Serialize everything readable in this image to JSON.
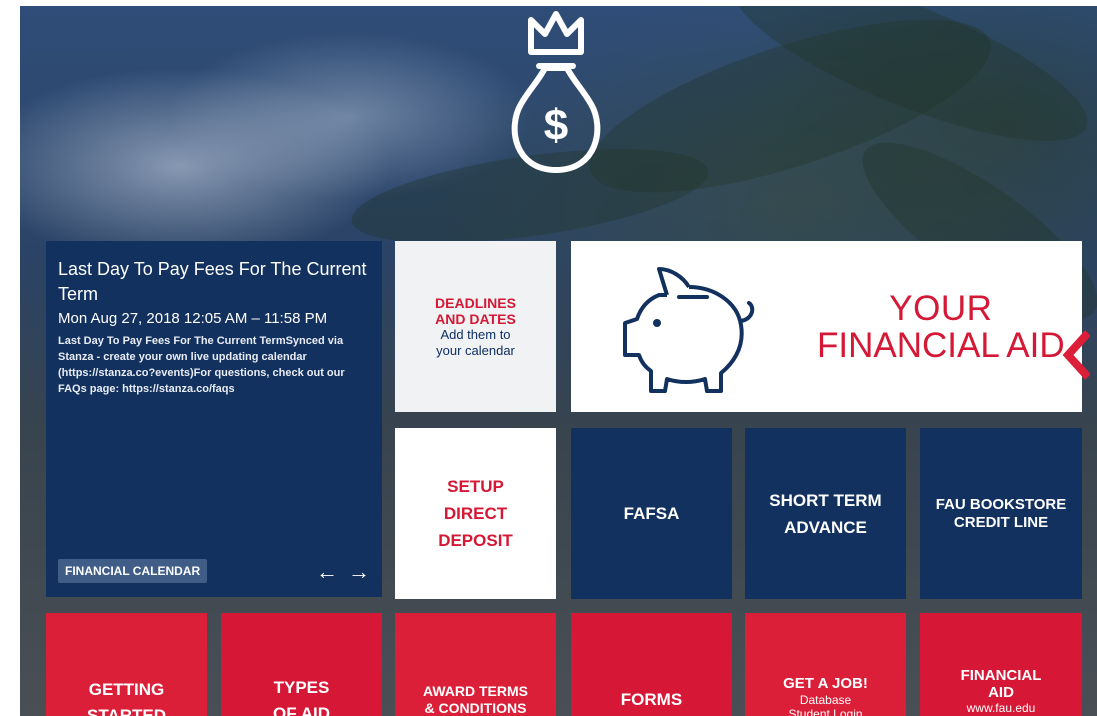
{
  "calendar": {
    "title": "Last Day To Pay Fees For The Current Term",
    "datetime": "Mon Aug 27, 2018 12:05 AM – 11:58 PM",
    "description": "Last Day To Pay Fees For The Current TermSynced via Stanza - create your own live updating calendar (https://stanza.co?events)For questions, check out our FAQs page: https://stanza.co/faqs",
    "button_label": "FINANCIAL CALENDAR",
    "prev_arrow": "←",
    "next_arrow": "→"
  },
  "tiles": {
    "deadlines": {
      "line1": "DEADLINES",
      "line2": "AND DATES",
      "line3": "Add them to",
      "line4": "your calendar"
    },
    "hero": {
      "line1": "YOUR",
      "line2": "FINANCIAL AID"
    },
    "direct_deposit": {
      "line1": "SETUP",
      "line2": "DIRECT",
      "line3": "DEPOSIT"
    },
    "fafsa": {
      "label": "FAFSA"
    },
    "short_term": {
      "line1": "SHORT TERM",
      "line2": "ADVANCE"
    },
    "bookstore": {
      "line1": "FAU BOOKSTORE",
      "line2": "CREDIT LINE"
    },
    "getting_started": {
      "line1": "GETTING",
      "line2": "STARTED"
    },
    "types_of_aid": {
      "line1": "TYPES",
      "line2": "OF AID"
    },
    "award_terms": {
      "line1": "AWARD TERMS",
      "line2": "& CONDITIONS"
    },
    "forms": {
      "label": "FORMS"
    },
    "get_a_job": {
      "line1": "GET A JOB!",
      "line2": "Database",
      "line3": "Student Login"
    },
    "financial_aid_site": {
      "line1": "FINANCIAL",
      "line2": "AID",
      "line3": "www.fau.edu"
    }
  },
  "icons": {
    "top": "money-bag-crown-icon",
    "hero": "piggy-bank-icon"
  },
  "colors": {
    "navy": "#12315f",
    "red": "#dc1f39",
    "white": "#ffffff",
    "light_grey": "#f1f2f4"
  }
}
